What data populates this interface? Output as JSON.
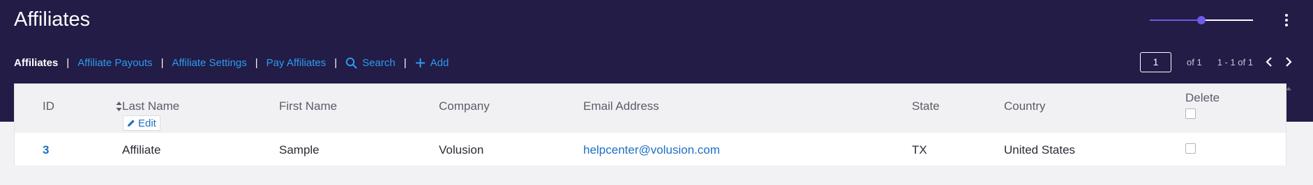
{
  "title": "Affiliates",
  "zoom_slider": {
    "value": 0.5
  },
  "nav": {
    "active": "Affiliates",
    "separator": "|",
    "links": [
      "Affiliate Payouts",
      "Affiliate Settings",
      "Pay Affiliates"
    ],
    "search": "Search",
    "add": "Add"
  },
  "pager": {
    "page": "1",
    "of": "of 1",
    "range": "1 - 1 of 1"
  },
  "table": {
    "columns": {
      "id": "ID",
      "last_name": "Last Name",
      "first_name": "First Name",
      "company": "Company",
      "email": "Email Address",
      "state": "State",
      "country": "Country",
      "delete": "Delete"
    },
    "edit_label": "Edit",
    "rows": [
      {
        "id": "3",
        "last_name": "Affiliate",
        "first_name": "Sample",
        "company": "Volusion",
        "email": "helpcenter@volusion.com",
        "state": "TX",
        "country": "United States"
      }
    ]
  },
  "colors": {
    "header_bg": "#221c46",
    "accent": "#6c5ce7",
    "link": "#2d9cf0",
    "table_link": "#1d6fc4"
  }
}
